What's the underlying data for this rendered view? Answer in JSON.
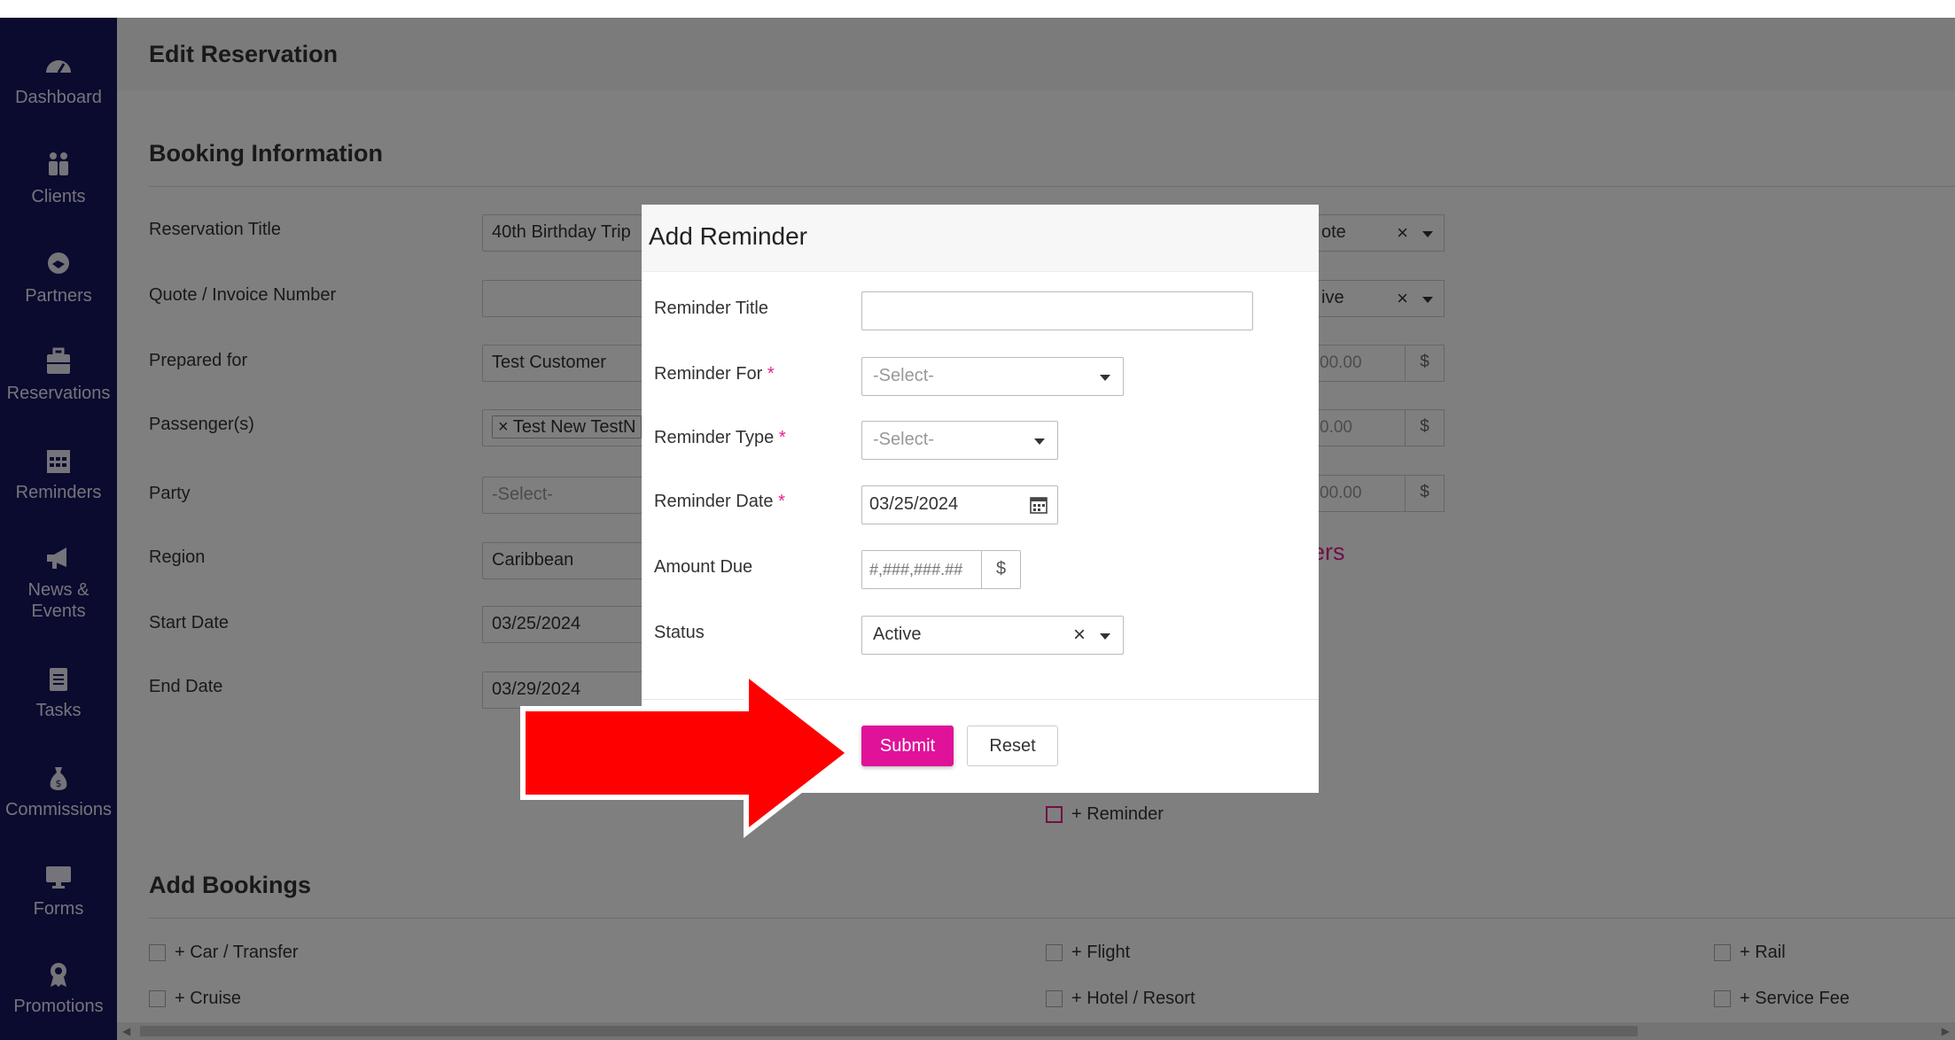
{
  "sidebar": {
    "items": [
      {
        "label": "Dashboard",
        "icon": "dashboard-icon"
      },
      {
        "label": "Clients",
        "icon": "clients-icon"
      },
      {
        "label": "Partners",
        "icon": "partners-icon"
      },
      {
        "label": "Reservations",
        "icon": "reservations-icon"
      },
      {
        "label": "Reminders",
        "icon": "calendar-icon"
      },
      {
        "label": "News &",
        "label2": "Events",
        "icon": "megaphone-icon"
      },
      {
        "label": "Tasks",
        "icon": "clipboard-icon"
      },
      {
        "label": "Commissions",
        "icon": "money-bag-icon"
      },
      {
        "label": "Forms",
        "icon": "monitor-icon"
      },
      {
        "label": "Promotions",
        "icon": "award-icon"
      }
    ]
  },
  "page": {
    "title": "Edit Reservation",
    "booking_section": "Booking Information",
    "fields": {
      "reservation_title": {
        "label": "Reservation Title",
        "value": "40th Birthday Trip"
      },
      "quote_invoice": {
        "label": "Quote / Invoice Number",
        "value": ""
      },
      "prepared_for": {
        "label": "Prepared for",
        "value": "Test Customer"
      },
      "passengers": {
        "label": "Passenger(s)",
        "tag": "Test New TestN"
      },
      "party": {
        "label": "Party",
        "placeholder": "-Select-"
      },
      "region": {
        "label": "Region",
        "value": "Caribbean"
      },
      "start_date": {
        "label": "Start Date",
        "value": "03/25/2024"
      },
      "end_date": {
        "label": "End Date",
        "value": "03/29/2024"
      }
    },
    "right_column": {
      "select1": "ote",
      "select2": "ive",
      "money1": "00.00",
      "money2": "0.00",
      "money3": "00.00",
      "currency": "$",
      "pink_text": "ers",
      "reminder_check": "+ Reminder"
    },
    "add_bookings": {
      "title": "Add Bookings",
      "items": [
        "+ Car / Transfer",
        "+ Flight",
        "+ Rail",
        "+ Cruise",
        "+ Hotel / Resort",
        "+ Service Fee"
      ]
    }
  },
  "modal": {
    "title": "Add Reminder",
    "fields": {
      "title": {
        "label": "Reminder Title",
        "value": ""
      },
      "for": {
        "label": "Reminder For",
        "placeholder": "-Select-",
        "required": "*"
      },
      "type": {
        "label": "Reminder Type",
        "placeholder": "-Select-",
        "required": "*"
      },
      "date": {
        "label": "Reminder Date",
        "value": "03/25/2024",
        "required": "*"
      },
      "amount": {
        "label": "Amount Due",
        "placeholder": "#,###,###.##",
        "currency": "$"
      },
      "status": {
        "label": "Status",
        "value": "Active"
      }
    },
    "submit": "Submit",
    "reset": "Reset"
  },
  "colors": {
    "sidebar": "#16145f",
    "accent": "#e0129a",
    "arrow": "#ff0000"
  }
}
